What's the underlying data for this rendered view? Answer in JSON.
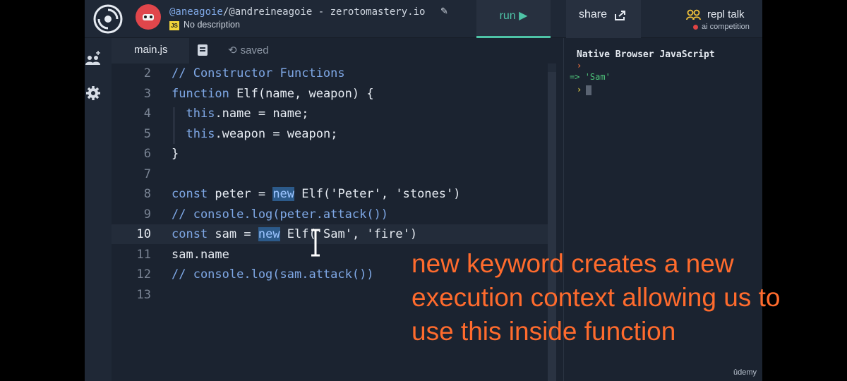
{
  "header": {
    "owner": "@aneagoie",
    "repl_path_rest": "/@andreineagoie - zerotomastery.io",
    "lang_badge": "JS",
    "description": "No description",
    "run_label": "run ▶",
    "share_label": "share",
    "talk_title": "repl talk",
    "talk_subtitle": "ai competition"
  },
  "tabs": {
    "file": "main.js",
    "status": "saved"
  },
  "editor": {
    "lines": [
      {
        "n": "2",
        "parts": [
          {
            "t": "// Constructor Functions",
            "c": "c-com"
          }
        ]
      },
      {
        "n": "3",
        "parts": [
          {
            "t": "function",
            "c": "c-kw"
          },
          {
            "t": " Elf(name, weapon) {",
            "c": ""
          }
        ]
      },
      {
        "n": "4",
        "parts": [
          {
            "t": "  ",
            "c": ""
          },
          {
            "t": "this",
            "c": "c-kw"
          },
          {
            "t": ".name = name;",
            "c": ""
          }
        ]
      },
      {
        "n": "5",
        "parts": [
          {
            "t": "  ",
            "c": ""
          },
          {
            "t": "this",
            "c": "c-kw"
          },
          {
            "t": ".weapon = weapon;",
            "c": ""
          }
        ]
      },
      {
        "n": "6",
        "parts": [
          {
            "t": "}",
            "c": ""
          }
        ]
      },
      {
        "n": "7",
        "parts": []
      },
      {
        "n": "8",
        "parts": [
          {
            "t": "const",
            "c": "c-kw"
          },
          {
            "t": " peter = ",
            "c": ""
          },
          {
            "t": "new",
            "c": "c-sel"
          },
          {
            "t": " Elf(",
            "c": ""
          },
          {
            "t": "'Peter'",
            "c": "c-str"
          },
          {
            "t": ", ",
            "c": ""
          },
          {
            "t": "'stones'",
            "c": "c-str"
          },
          {
            "t": ")",
            "c": ""
          }
        ]
      },
      {
        "n": "9",
        "parts": [
          {
            "t": "// console.log(peter.attack())",
            "c": "c-com"
          }
        ]
      },
      {
        "n": "10",
        "active": true,
        "parts": [
          {
            "t": "const",
            "c": "c-kw"
          },
          {
            "t": " sam = ",
            "c": ""
          },
          {
            "t": "new",
            "c": "c-sel"
          },
          {
            "t": " Elf(",
            "c": ""
          },
          {
            "t": "'Sam'",
            "c": "c-str"
          },
          {
            "t": ", ",
            "c": ""
          },
          {
            "t": "'fire'",
            "c": "c-str"
          },
          {
            "t": ")",
            "c": ""
          }
        ]
      },
      {
        "n": "11",
        "parts": [
          {
            "t": "sam.name",
            "c": ""
          }
        ]
      },
      {
        "n": "12",
        "parts": [
          {
            "t": "// console.log(sam.attack())",
            "c": "c-com"
          }
        ]
      },
      {
        "n": "13",
        "parts": []
      }
    ]
  },
  "console": {
    "title": "Native Browser JavaScript",
    "prompt_char": "›",
    "result_arrow": "=>",
    "result_value": "'Sam'"
  },
  "caption": {
    "lines": [
      "new keyword creates a new",
      "execution context allowing us to",
      "use this inside function"
    ]
  },
  "watermark": "ûdemy",
  "colors": {
    "accent_run": "#4ec3a6",
    "caption": "#ff6b2d",
    "keyword": "#7fa8e6",
    "selection": "#2c5a8a"
  }
}
